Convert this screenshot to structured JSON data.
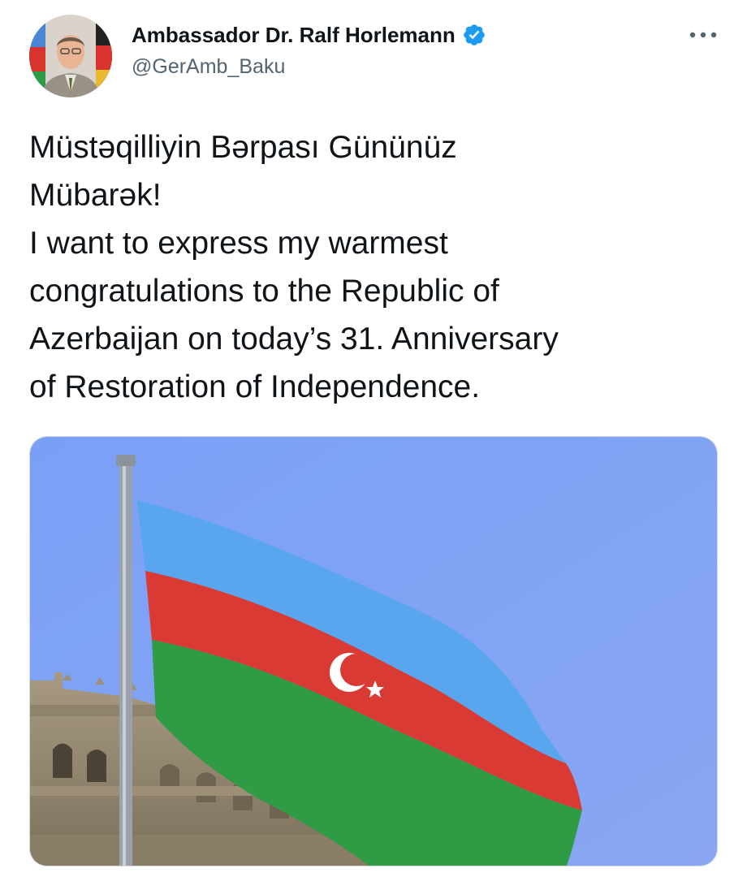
{
  "author": {
    "display_name": "Ambassador Dr. Ralf Horlemann",
    "handle": "@GerAmb_Baku",
    "verified": true,
    "verified_color": "#1d9bf0"
  },
  "menu": {
    "icon": "more-horizontal-icon"
  },
  "tweet": {
    "text": "Müstəqilliyin Bərpası Gününüz\nMübarək!\nI want to express my warmest\ncongratulations to the Republic of\nAzerbaijan on today’s 31. Anniversary\nof Restoration of Independence."
  },
  "media": {
    "kind": "photo",
    "subject": "azerbaijan-flag-photo",
    "colors": {
      "sky": "#7d9cf4",
      "flag_blue": "#5aa6ee",
      "flag_red": "#d93a33",
      "flag_green": "#2f9b44"
    }
  }
}
